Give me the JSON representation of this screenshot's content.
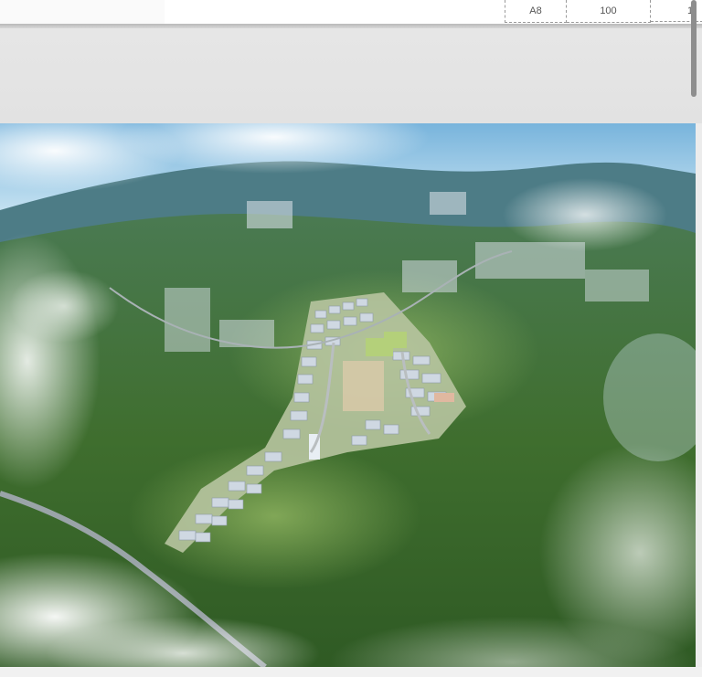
{
  "table_fragment": {
    "cells": [
      "A8",
      "100",
      "1"
    ]
  },
  "image": {
    "alt_subject": "aerial-rendering-industrial-park"
  },
  "colors": {
    "forest": "#3f6e2e",
    "sky": "#8fc3e0",
    "roof": "#c9d3dc",
    "page_bg": "#ececec"
  }
}
